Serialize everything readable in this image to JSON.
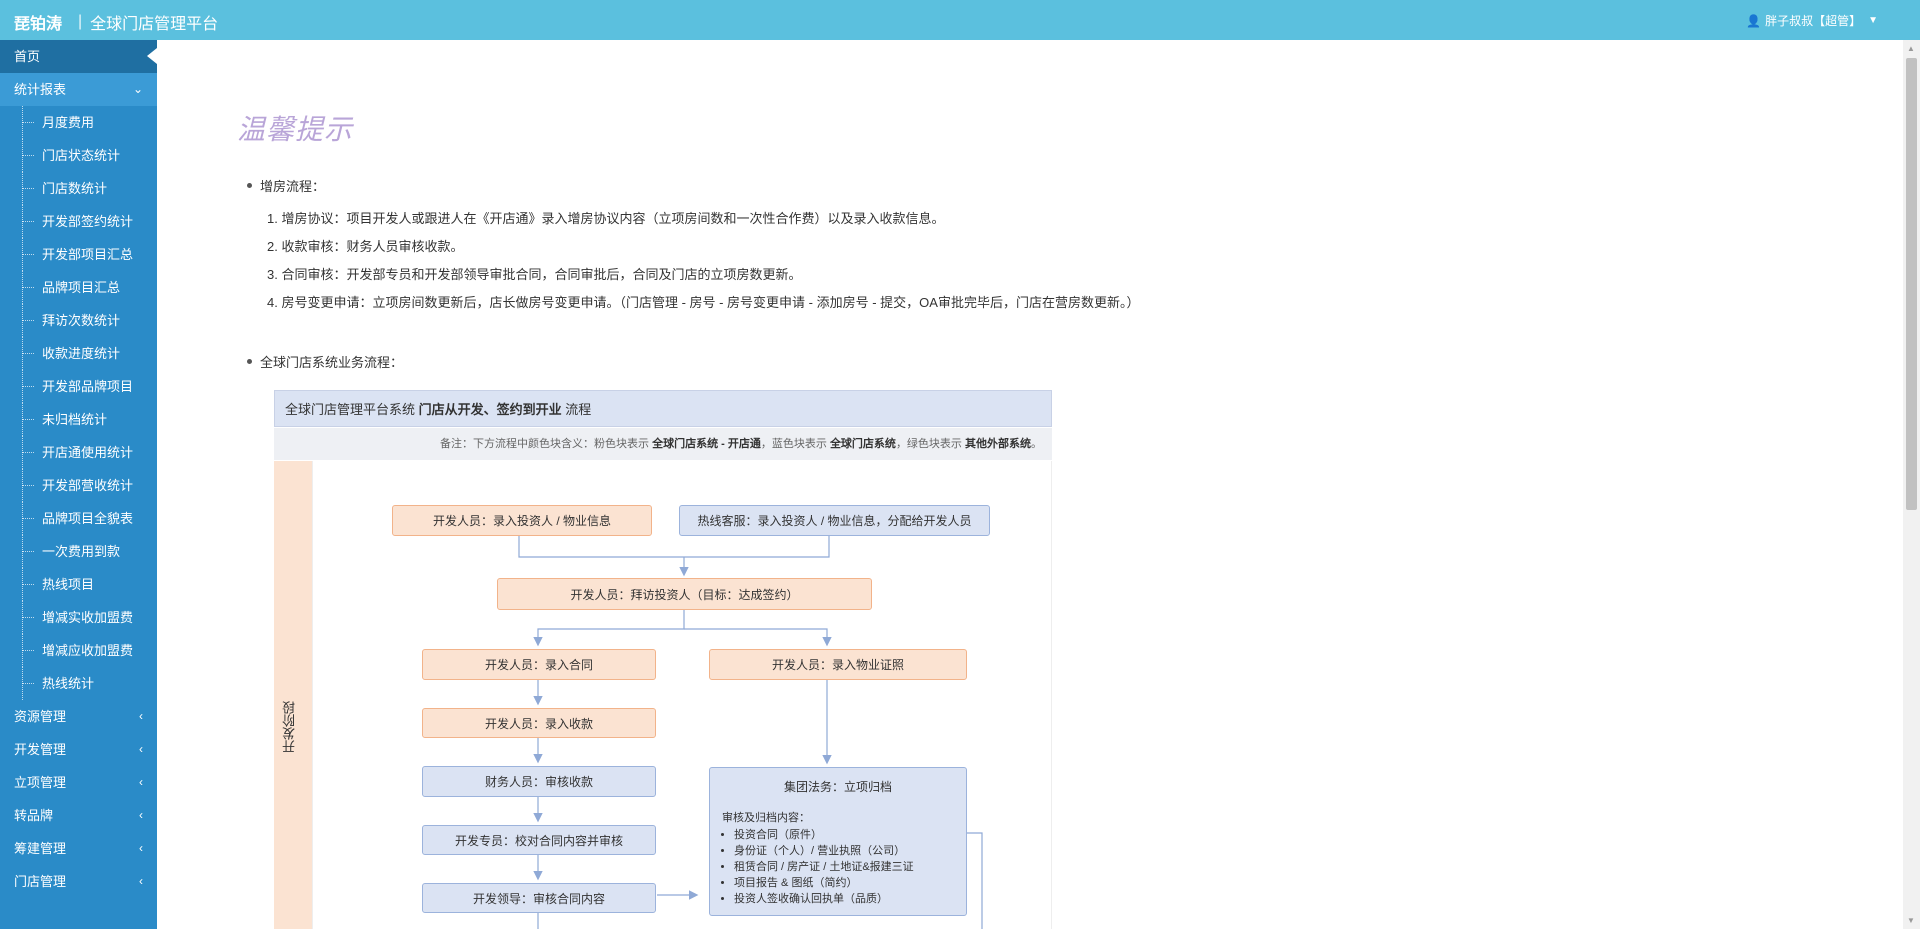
{
  "header": {
    "logo": "琵铂涛",
    "separator": "|",
    "title": "全球门店管理平台",
    "user": "胖子叔叔【超管】"
  },
  "sidebar": {
    "items": [
      {
        "label": "首页"
      },
      {
        "label": "统计报表"
      },
      {
        "label": "资源管理"
      },
      {
        "label": "开发管理"
      },
      {
        "label": "立项管理"
      },
      {
        "label": "转品牌"
      },
      {
        "label": "筹建管理"
      },
      {
        "label": "门店管理"
      }
    ],
    "report_sub": [
      "月度费用",
      "门店状态统计",
      "门店数统计",
      "开发部签约统计",
      "开发部项目汇总",
      "品牌项目汇总",
      "拜访次数统计",
      "收款进度统计",
      "开发部品牌项目",
      "未归档统计",
      "开店通使用统计",
      "开发部营收统计",
      "品牌项目全貌表",
      "一次费用到款",
      "热线项目",
      "增减实收加盟费",
      "增减应收加盟费",
      "热线统计"
    ]
  },
  "main": {
    "tip_title": "温馨提示",
    "section1": {
      "heading": "增房流程：",
      "steps": [
        "1. 增房协议：项目开发人或跟进人在《开店通》录入增房协议内容（立项房间数和一次性合作费）以及录入收款信息。",
        "2. 收款审核：财务人员审核收款。",
        "3. 合同审核：开发部专员和开发部领导审批合同，合同审批后，合同及门店的立项房数更新。",
        "4. 房号变更申请：立项房间数更新后，店长做房号变更申请。（门店管理 - 房号 - 房号变更申请 - 添加房号 - 提交，OA审批完毕后，门店在营房数更新。）"
      ]
    },
    "section2": {
      "heading": "全球门店系统业务流程："
    }
  },
  "flow": {
    "title_prefix": "全球门店管理平台系统 ",
    "title_bold": "门店从开发、签约到开业",
    "title_suffix": " 流程",
    "note_1": "备注：下方流程中颜色块含义：粉色块表示 ",
    "note_2": "全球门店系统 - 开店通",
    "note_3": "，蓝色块表示 ",
    "note_4": "全球门店系统",
    "note_5": "，绿色块表示 ",
    "note_6": "其他外部系统",
    "note_7": "。",
    "lane": "开发阶段",
    "boxes": {
      "dev_input": "开发人员：录入投资人 / 物业信息",
      "hotline": "热线客服：录入投资人 / 物业信息，分配给开发人员",
      "visit": "开发人员：拜访投资人（目标：达成签约）",
      "contract": "开发人员：录入合同",
      "property_cert": "开发人员：录入物业证照",
      "receipt": "开发人员：录入收款",
      "finance": "财务人员：审核收款",
      "dev_special": "开发专员：校对合同内容并审核",
      "dev_lead": "开发领导：审核合同内容",
      "legal_title": "集团法务：立项归档",
      "legal_sub": "审核及归档内容：",
      "legal_items": [
        "投资合同（原件）",
        "身份证（个人）/ 营业执照（公司）",
        "租赁合同 / 房产证 / 土地证&报建三证",
        "项目报告 & 图纸（简约）",
        "投资人签收确认回执单（品质）"
      ]
    },
    "colors": {
      "orange_fill": "#fbe3d2",
      "orange_border": "#f2b38a",
      "blue_fill": "#dbe3f3",
      "blue_border": "#9cb3dc",
      "connector": "#8fa9d6"
    }
  }
}
